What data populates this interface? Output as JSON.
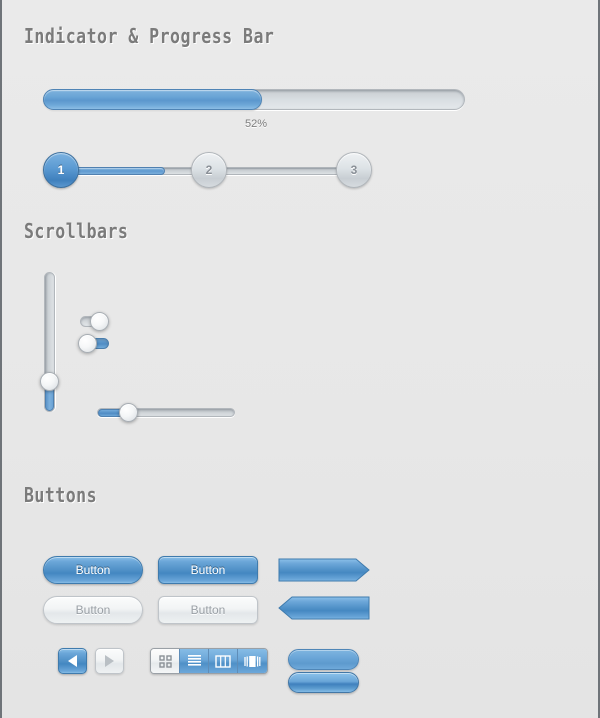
{
  "sections": [
    {
      "id": "indicator",
      "title": "Indicator & Progress Bar"
    },
    {
      "id": "scrollbars",
      "title": "Scrollbars"
    },
    {
      "id": "buttons",
      "title": "Buttons"
    }
  ],
  "progress": {
    "value": 52,
    "label": "52%",
    "track_color": "#d7dcdf",
    "fill_color": "#6aa5d6"
  },
  "steps": {
    "items": [
      {
        "label": "1",
        "state": "active"
      },
      {
        "label": "2",
        "state": "inactive"
      },
      {
        "label": "3",
        "state": "inactive"
      }
    ],
    "active_color": "#5b9ad2",
    "inactive_color": "#d3d8dc"
  },
  "scrollbars": {
    "vertical_slider": {
      "name": "vertical-slider",
      "value": 22,
      "orientation": "vertical"
    },
    "horizontal_slider": {
      "name": "horizontal-slider",
      "value": 23,
      "orientation": "horizontal"
    },
    "toggles": [
      {
        "name": "toggle-switch-off",
        "state": "off",
        "knob_position": "right"
      },
      {
        "name": "toggle-switch-on",
        "state": "on",
        "knob_position": "left"
      }
    ]
  },
  "buttons": {
    "primary_pill": {
      "label": "Button",
      "style": "blue-pill"
    },
    "primary_rect": {
      "label": "Button",
      "style": "blue-rounded"
    },
    "disabled_pill": {
      "label": "Button",
      "style": "gray-pill"
    },
    "disabled_rect": {
      "label": "Button",
      "style": "gray-rounded"
    },
    "prev_arrow": {
      "icon": "triangle-left-icon",
      "state": "active"
    },
    "next_arrow": {
      "icon": "triangle-right-icon",
      "state": "inactive"
    },
    "banner_right": {
      "icon": "arrow-banner-right",
      "style": "blue"
    },
    "banner_left": {
      "icon": "arrow-banner-left",
      "style": "blue"
    },
    "pill_flat": {
      "style": "blue-flat"
    },
    "pill_gloss": {
      "style": "blue-gloss"
    },
    "view_modes": [
      {
        "icon": "grid-view-icon",
        "selected": true
      },
      {
        "icon": "list-view-icon",
        "selected": false
      },
      {
        "icon": "column-view-icon",
        "selected": false
      },
      {
        "icon": "coverflow-view-icon",
        "selected": false
      }
    ]
  },
  "theme": {
    "background": "#e9e9e9",
    "accent": "#5b9ad2",
    "heading_color": "#7b7b7b",
    "border_color": "#6f7479"
  }
}
